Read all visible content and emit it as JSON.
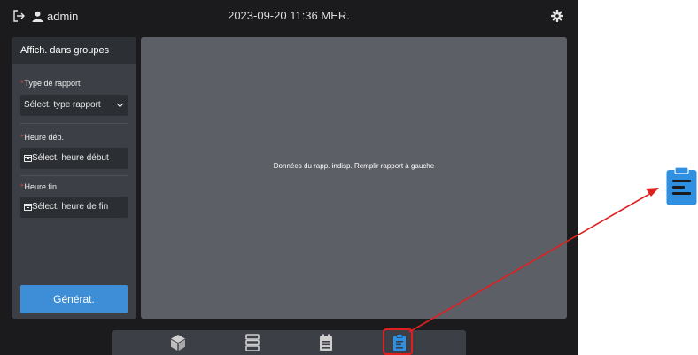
{
  "topbar": {
    "user": "admin",
    "datetime": "2023-09-20 11:36 MER."
  },
  "left_panel": {
    "header": "Affich. dans groupes",
    "report_type": {
      "label": "Type de rapport",
      "placeholder": "Sélect. type rapport"
    },
    "start_time": {
      "label": "Heure déb.",
      "placeholder": "Sélect. heure début"
    },
    "end_time": {
      "label": "Heure fin",
      "placeholder": "Sélect. heure de fin"
    },
    "generate_label": "Générat."
  },
  "main": {
    "empty_message": "Données du rapp. indisp. Remplir rapport à gauche"
  },
  "nav": {
    "items": [
      "cube-icon",
      "server-list-icon",
      "calendar-icon",
      "report-clipboard-icon"
    ],
    "active": "report-clipboard-icon"
  },
  "colors": {
    "accent": "#3d8ed6",
    "required": "#e0413b",
    "highlight": "#e02020"
  }
}
